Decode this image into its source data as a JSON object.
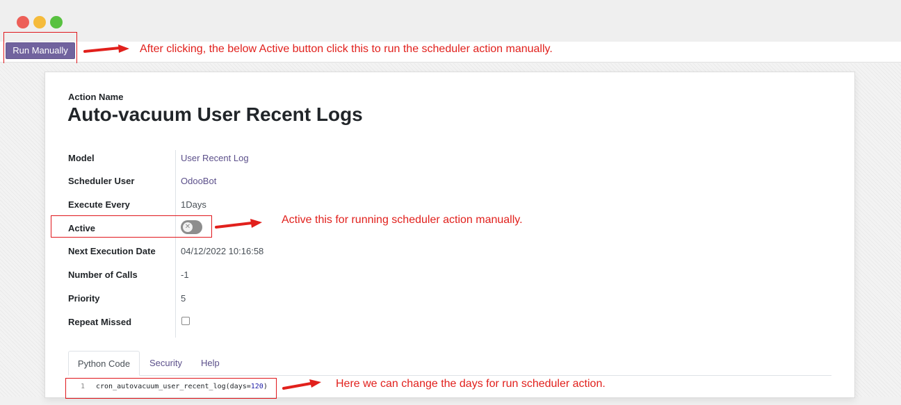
{
  "toolbar": {
    "run_manually_label": "Run Manually"
  },
  "annotations": {
    "run_note": "After clicking, the below Active button click this to run the scheduler action manually.",
    "active_note": "Active this for running scheduler action manually.",
    "code_note": "Here we can change the days for run scheduler action."
  },
  "form": {
    "title_caption": "Action Name",
    "title": "Auto-vacuum User Recent Logs",
    "fields": {
      "model": {
        "label": "Model",
        "value": "User Recent Log"
      },
      "scheduler_user": {
        "label": "Scheduler User",
        "value": "OdooBot"
      },
      "execute_every": {
        "label": "Execute Every",
        "value": "1Days"
      },
      "active": {
        "label": "Active",
        "value": false
      },
      "next_execution_date": {
        "label": "Next Execution Date",
        "value": "04/12/2022 10:16:58"
      },
      "number_of_calls": {
        "label": "Number of Calls",
        "value": "-1"
      },
      "priority": {
        "label": "Priority",
        "value": "5"
      },
      "repeat_missed": {
        "label": "Repeat Missed",
        "value": false
      }
    }
  },
  "tabs": [
    {
      "label": "Python Code",
      "active": true
    },
    {
      "label": "Security",
      "active": false
    },
    {
      "label": "Help",
      "active": false
    }
  ],
  "code": {
    "line_number": "1",
    "prefix": "cron_autovacuum_user_recent_log(days=",
    "arg": "120",
    "suffix": ")"
  },
  "icons": {
    "toggle_off": "x-icon",
    "annotation": "arrow-right-icon"
  },
  "colors": {
    "accent": "#71639e",
    "annotation": "#e1201c",
    "link": "#5b4f8a"
  }
}
